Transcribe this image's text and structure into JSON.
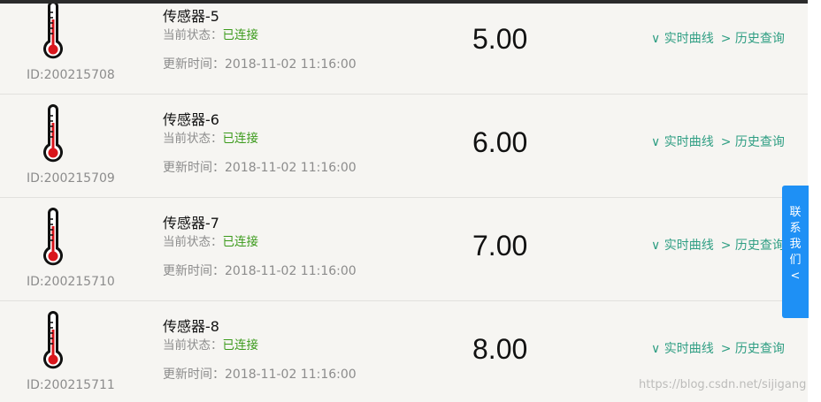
{
  "sensors": [
    {
      "name": "传感器-5",
      "status_label": "当前状态：",
      "status_value": "已连接",
      "time_label": "更新时间：",
      "time_value": "2018-11-02 11:16:00",
      "id_text": "ID:200215708",
      "value": "5.00",
      "realtime_link": "∨ 实时曲线",
      "history_link": "> 历史查询"
    },
    {
      "name": "传感器-6",
      "status_label": "当前状态：",
      "status_value": "已连接",
      "time_label": "更新时间：",
      "time_value": "2018-11-02 11:16:00",
      "id_text": "ID:200215709",
      "value": "6.00",
      "realtime_link": "∨ 实时曲线",
      "history_link": "> 历史查询"
    },
    {
      "name": "传感器-7",
      "status_label": "当前状态：",
      "status_value": "已连接",
      "time_label": "更新时间：",
      "time_value": "2018-11-02 11:16:00",
      "id_text": "ID:200215710",
      "value": "7.00",
      "realtime_link": "∨ 实时曲线",
      "history_link": "> 历史查询"
    },
    {
      "name": "传感器-8",
      "status_label": "当前状态：",
      "status_value": "已连接",
      "time_label": "更新时间：",
      "time_value": "2018-11-02 11:16:00",
      "id_text": "ID:200215711",
      "value": "8.00",
      "realtime_link": "∨ 实时曲线",
      "history_link": "> 历史查询"
    }
  ],
  "contact": {
    "chars": [
      "联",
      "系",
      "我",
      "们",
      "<"
    ]
  },
  "watermark": "https://blog.csdn.net/sijigang",
  "colors": {
    "status_ok": "#3a9a1a",
    "link": "#2f9e83",
    "contact_bg": "#1e90f5",
    "thermo_red": "#d9161c"
  },
  "icons": {
    "sensor": "thermometer-icon"
  }
}
